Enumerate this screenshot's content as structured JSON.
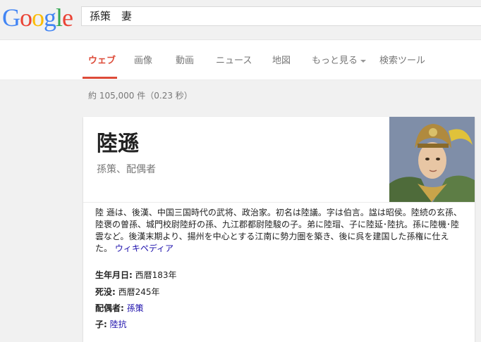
{
  "logo": {
    "letters": [
      "G",
      "o",
      "o",
      "g",
      "l",
      "e"
    ],
    "colors": [
      "#4285f4",
      "#ea4335",
      "#fbbc05",
      "#4285f4",
      "#34a853",
      "#ea4335"
    ]
  },
  "search": {
    "query": "孫策　妻"
  },
  "tabs": [
    {
      "label": "ウェブ",
      "active": true
    },
    {
      "label": "画像"
    },
    {
      "label": "動画"
    },
    {
      "label": "ニュース"
    },
    {
      "label": "地図"
    },
    {
      "label": "もっと見る"
    },
    {
      "label": "検索ツール"
    }
  ],
  "result_stats": "約 105,000 件（0.23 秒）",
  "knowledge_panel": {
    "title": "陸遜",
    "subtitle": "孫策、配偶者",
    "description": "陸 遜は、後漢、中国三国時代の武将、政治家。初名は陸議。字は伯言。諡は昭侯。陸続の玄孫、陸褒の曽孫、城門校尉陸紆の孫、九江郡都尉陸駿の子。弟に陸瑁、子に陸延･陸抗。孫に陸機･陸雲など。後漢末期より、揚州を中心とする江南に勢力圏を築き、後に呉を建国した孫権に仕えた。",
    "source_link": "ウィキペディア",
    "facts": [
      {
        "label": "生年月日:",
        "value": "西暦183年",
        "link": false
      },
      {
        "label": "死没:",
        "value": "西暦245年",
        "link": false
      },
      {
        "label": "配偶者:",
        "value": "孫策",
        "link": true
      },
      {
        "label": "子:",
        "value": "陸抗",
        "link": true
      }
    ]
  }
}
